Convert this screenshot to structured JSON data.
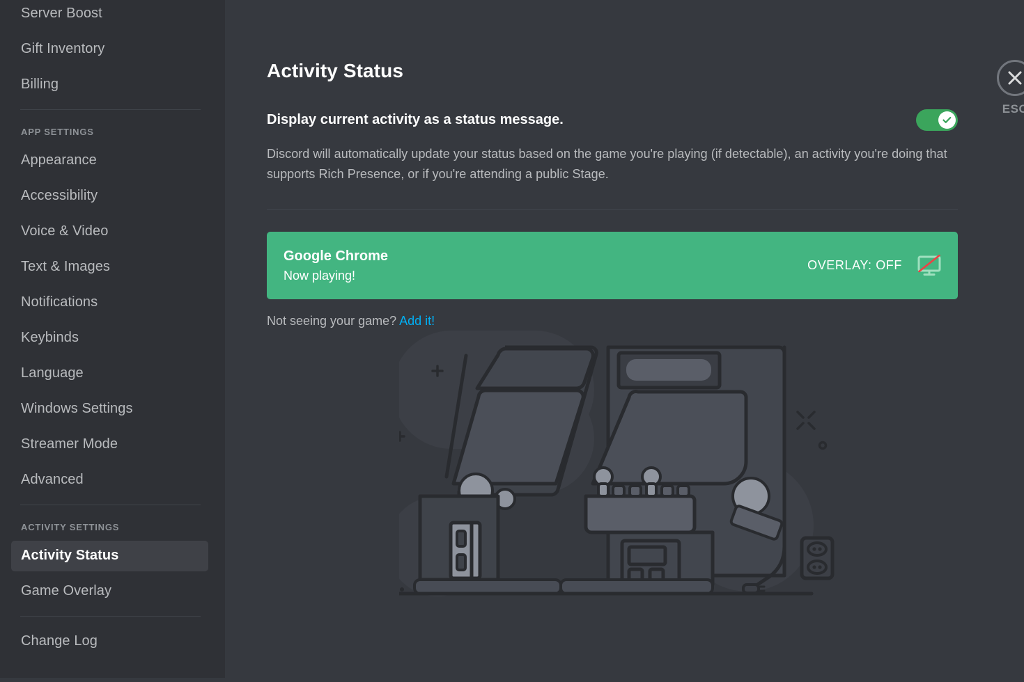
{
  "sidebar": {
    "groups": [
      {
        "header": null,
        "items": [
          {
            "label": "Server Boost",
            "active": false
          },
          {
            "label": "Gift Inventory",
            "active": false
          },
          {
            "label": "Billing",
            "active": false
          }
        ]
      },
      {
        "header": "APP SETTINGS",
        "items": [
          {
            "label": "Appearance",
            "active": false
          },
          {
            "label": "Accessibility",
            "active": false
          },
          {
            "label": "Voice & Video",
            "active": false
          },
          {
            "label": "Text & Images",
            "active": false
          },
          {
            "label": "Notifications",
            "active": false
          },
          {
            "label": "Keybinds",
            "active": false
          },
          {
            "label": "Language",
            "active": false
          },
          {
            "label": "Windows Settings",
            "active": false
          },
          {
            "label": "Streamer Mode",
            "active": false
          },
          {
            "label": "Advanced",
            "active": false
          }
        ]
      },
      {
        "header": "ACTIVITY SETTINGS",
        "items": [
          {
            "label": "Activity Status",
            "active": true
          },
          {
            "label": "Game Overlay",
            "active": false
          }
        ]
      },
      {
        "header": null,
        "items": [
          {
            "label": "Change Log",
            "active": false
          }
        ]
      }
    ]
  },
  "main": {
    "page_title": "Activity Status",
    "toggle": {
      "label": "Display current activity as a status message.",
      "state": "on",
      "icon": "check-icon"
    },
    "description": "Discord will automatically update your status based on the game you're playing (if detectable), an activity you're doing that supports Rich Presence, or if you're attending a public Stage.",
    "game_card": {
      "name": "Google Chrome",
      "subtitle": "Now playing!",
      "overlay_label": "OVERLAY: OFF",
      "overlay_icon": "monitor-off-icon"
    },
    "add_game": {
      "prompt": "Not seeing your game?",
      "link_label": "Add it!"
    },
    "illustration": "arcade-cabinets-illustration"
  },
  "close": {
    "icon": "close-icon",
    "label": "ESC"
  },
  "colors": {
    "sidebar_bg": "#2f3136",
    "main_bg": "#36393f",
    "accent_green": "#43b581",
    "toggle_green": "#3ba55c",
    "link_blue": "#00aff4",
    "text_primary": "#ffffff",
    "text_muted": "#b9bbbe",
    "text_header": "#8e9297",
    "strike_red": "#ed4245"
  }
}
